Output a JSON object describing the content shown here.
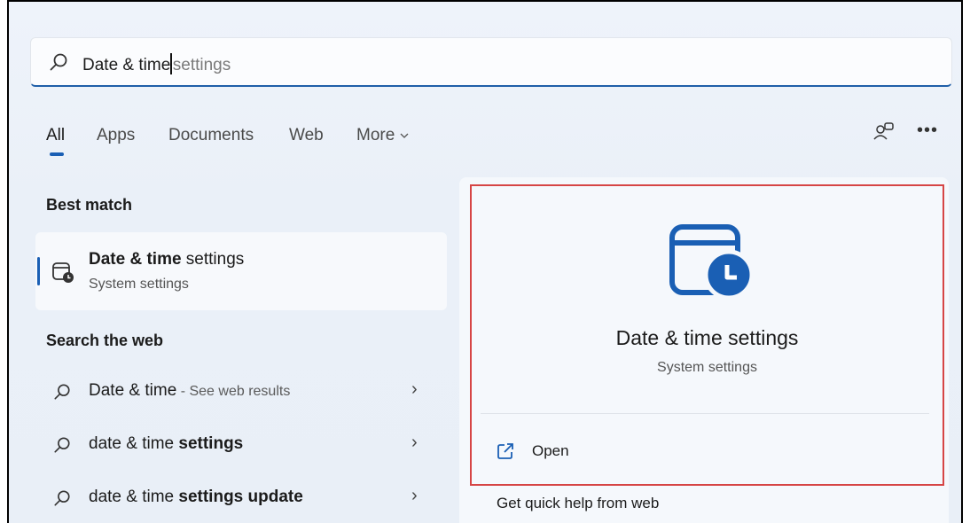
{
  "search": {
    "typed": "Date & time",
    "suggestion": "settings"
  },
  "tabs": [
    {
      "label": "All",
      "active": true
    },
    {
      "label": "Apps"
    },
    {
      "label": "Documents"
    },
    {
      "label": "Web"
    },
    {
      "label": "More"
    }
  ],
  "best_match": {
    "heading": "Best match",
    "title_bold": "Date & time",
    "title_rest": " settings",
    "subtitle": "System settings"
  },
  "search_web": {
    "heading": "Search the web",
    "items": [
      {
        "plain": "Date & time",
        "bold": "",
        "hint": " - See web results"
      },
      {
        "plain": "date & time ",
        "bold": "settings",
        "hint": ""
      },
      {
        "plain": "date & time ",
        "bold": "settings update",
        "hint": ""
      }
    ]
  },
  "preview": {
    "title": "Date & time settings",
    "subtitle": "System settings",
    "open_label": "Open",
    "quick_help": "Get quick help from web"
  },
  "colors": {
    "accent": "#1a5fb4",
    "highlight_border": "#d64545"
  }
}
